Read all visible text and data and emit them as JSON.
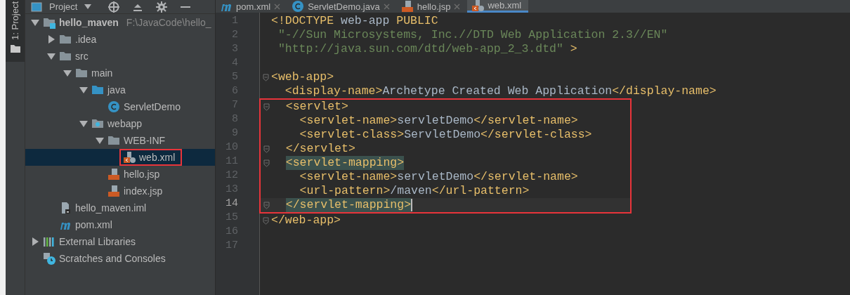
{
  "tool_strip": {
    "tabs": [
      {
        "label": "1: Project",
        "selected": true
      }
    ]
  },
  "project_panel": {
    "title": "Project",
    "tree": [
      {
        "label": "hello_maven",
        "path": "F:\\JavaCode\\hello_",
        "kind": "module",
        "expanded": true,
        "selected": false,
        "children": [
          {
            "label": ".idea",
            "kind": "folder",
            "expanded": false,
            "selected": false
          },
          {
            "label": "src",
            "kind": "folder",
            "expanded": true,
            "selected": false,
            "children": [
              {
                "label": "main",
                "kind": "folder",
                "expanded": true,
                "selected": false,
                "children": [
                  {
                    "label": "java",
                    "kind": "source-folder",
                    "expanded": true,
                    "selected": false,
                    "children": [
                      {
                        "label": "ServletDemo",
                        "kind": "class",
                        "selected": false
                      }
                    ]
                  },
                  {
                    "label": "webapp",
                    "kind": "web-folder",
                    "expanded": true,
                    "selected": false,
                    "children": [
                      {
                        "label": "WEB-INF",
                        "kind": "folder",
                        "expanded": true,
                        "selected": false,
                        "children": [
                          {
                            "label": "web.xml",
                            "kind": "xml",
                            "selected": true,
                            "boxed": true
                          }
                        ]
                      },
                      {
                        "label": "hello.jsp",
                        "kind": "jsp",
                        "selected": false
                      },
                      {
                        "label": "index.jsp",
                        "kind": "jsp",
                        "selected": false
                      }
                    ]
                  }
                ]
              }
            ]
          },
          {
            "label": "hello_maven.iml",
            "kind": "iml",
            "selected": false
          },
          {
            "label": "pom.xml",
            "kind": "maven",
            "selected": false
          }
        ]
      },
      {
        "label": "External Libraries",
        "kind": "libraries",
        "expanded": false,
        "selected": false
      },
      {
        "label": "Scratches and Consoles",
        "kind": "scratches",
        "selected": false
      }
    ]
  },
  "editor": {
    "tabs": [
      {
        "label": "pom.xml",
        "kind": "maven",
        "selected": false
      },
      {
        "label": "ServletDemo.java",
        "kind": "class",
        "selected": false
      },
      {
        "label": "hello.jsp",
        "kind": "jsp",
        "selected": false
      },
      {
        "label": "web.xml",
        "kind": "xml",
        "selected": true
      }
    ],
    "blocks": [
      {
        "boxed": false,
        "lines": [
          {
            "number": "1",
            "tokens": [
              {
                "kind": "keyword",
                "text": "<!DOCTYPE "
              },
              {
                "kind": "text",
                "text": "web-app "
              },
              {
                "kind": "keyword",
                "text": "PUBLIC"
              }
            ]
          },
          {
            "number": "2",
            "tokens": [
              {
                "kind": "string",
                "text": " \"-//Sun Microsystems, Inc.//DTD Web Application 2.3//EN\""
              }
            ]
          },
          {
            "number": "3",
            "tokens": [
              {
                "kind": "string",
                "text": " \"http://java.sun.com/dtd/web-app_2_3.dtd\""
              },
              {
                "kind": "keyword",
                "text": " >"
              }
            ]
          },
          {
            "number": "4"
          },
          {
            "number": "5",
            "fold": true,
            "tokens": [
              {
                "kind": "tag",
                "text": "<web-app>"
              }
            ]
          },
          {
            "number": "6",
            "tokens": [
              {
                "kind": "tag",
                "text": "  <display-name>"
              },
              {
                "kind": "text",
                "text": "Archetype Created Web Application"
              },
              {
                "kind": "tag",
                "text": "</display-name>"
              }
            ]
          }
        ]
      },
      {
        "boxed": true,
        "lines": [
          {
            "number": "7",
            "fold": true,
            "tokens": [
              {
                "kind": "tag",
                "text": "  <servlet>"
              }
            ]
          },
          {
            "number": "8",
            "tokens": [
              {
                "kind": "tag",
                "text": "    <servlet-name>"
              },
              {
                "kind": "text",
                "text": "servletDemo"
              },
              {
                "kind": "tag",
                "text": "</servlet-name>"
              }
            ]
          },
          {
            "number": "9",
            "tokens": [
              {
                "kind": "tag",
                "text": "    <servlet-class>"
              },
              {
                "kind": "text",
                "text": "ServletDemo"
              },
              {
                "kind": "tag",
                "text": "</servlet-class>"
              }
            ]
          },
          {
            "number": "10",
            "fold": true,
            "tokens": [
              {
                "kind": "tag",
                "text": "  </servlet>"
              }
            ]
          },
          {
            "number": "11",
            "fold": true,
            "tokens": [
              {
                "kind": "tag",
                "text": "  <servlet-mapping>",
                "matched": true
              }
            ]
          },
          {
            "number": "12",
            "tokens": [
              {
                "kind": "tag",
                "text": "    <servlet-name>"
              },
              {
                "kind": "text",
                "text": "servletDemo"
              },
              {
                "kind": "tag",
                "text": "</servlet-name>"
              }
            ]
          },
          {
            "number": "13",
            "tokens": [
              {
                "kind": "tag",
                "text": "    <url-pattern>"
              },
              {
                "kind": "text",
                "text": "/maven"
              },
              {
                "kind": "tag",
                "text": "</url-pattern>"
              }
            ]
          },
          {
            "number": "14",
            "fold": true,
            "current": true,
            "caret": true,
            "tokens": [
              {
                "kind": "tag",
                "text": "  </servlet-mapping>",
                "matched": true
              }
            ]
          }
        ]
      },
      {
        "boxed": false,
        "lines": [
          {
            "number": "15",
            "fold": true,
            "tokens": [
              {
                "kind": "tag",
                "text": "</web-app>"
              }
            ]
          },
          {
            "number": "16"
          },
          {
            "number": "17"
          }
        ]
      }
    ]
  }
}
